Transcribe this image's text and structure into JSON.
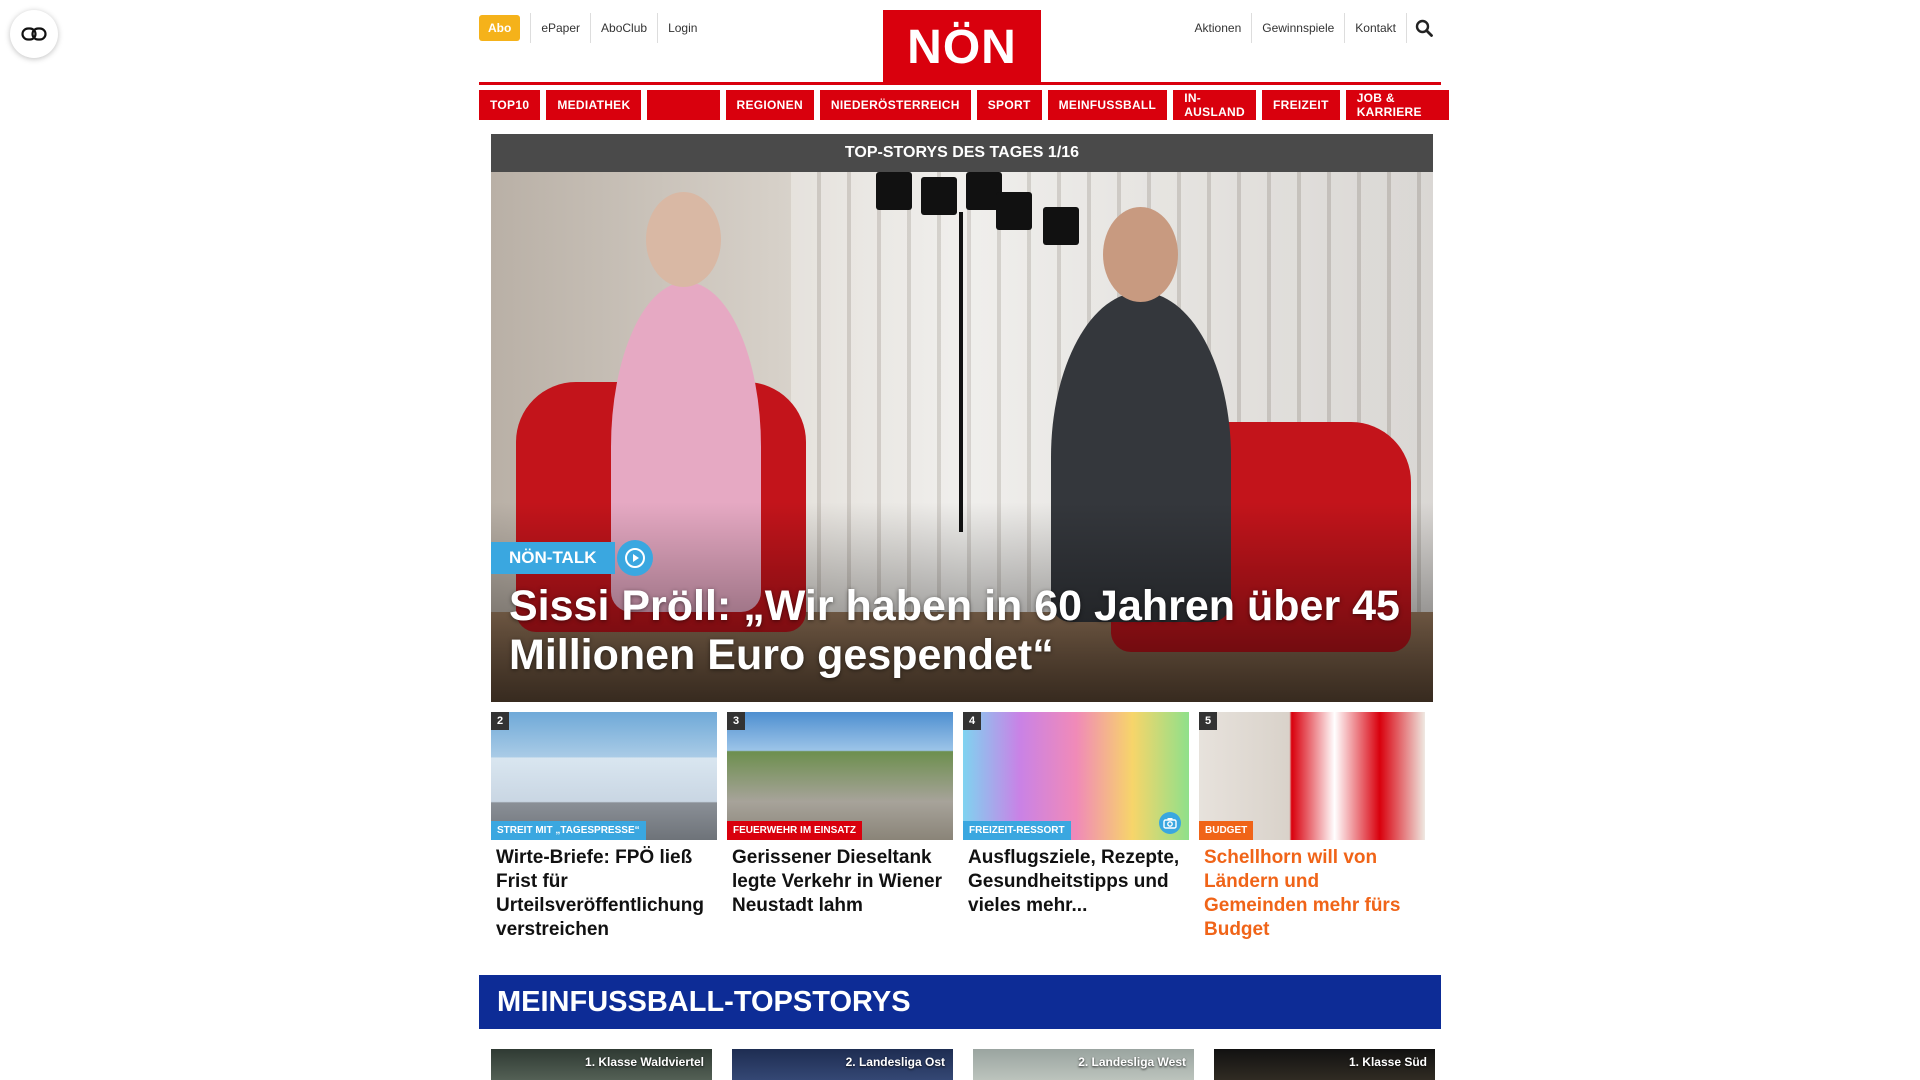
{
  "header": {
    "abo_label": "Abo",
    "left_links": [
      "ePaper",
      "AboClub",
      "Login"
    ],
    "logo_text": "NÖN",
    "right_links": [
      "Aktionen",
      "Gewinnspiele",
      "Kontakt"
    ]
  },
  "nav": {
    "items": [
      "TOP10",
      "MEDIATHEK",
      "",
      "REGIONEN",
      "NIEDERÖSTERREICH",
      "SPORT",
      "MEINFUSSBALL",
      "IN-AUSLAND",
      "FREIZEIT",
      "JOB & KARRIERE"
    ]
  },
  "hero": {
    "bar_label": "TOP-STORYS DES TAGES 1/16",
    "tag": "NÖN-TALK",
    "title": "Sissi Pröll: „Wir haben in 60 Jahren über 45 Millionen Euro gespendet“"
  },
  "cards": [
    {
      "rank": "2",
      "kicker": "STREIT MIT „TAGESPRESSE“",
      "title": "Wirte-Briefe: FPÖ ließ Frist für Urteilsveröffentlichung verstreichen"
    },
    {
      "rank": "3",
      "kicker": "FEUERWEHR IM EINSATZ",
      "title": "Gerissener Dieseltank legte Verkehr in Wiener Neustadt lahm"
    },
    {
      "rank": "4",
      "kicker": "FREIZEIT-RESSORT",
      "title": "Ausflugsziele, Rezepte, Gesundheitstipps und vieles mehr..."
    },
    {
      "rank": "5",
      "kicker": "BUDGET",
      "title": "Schellhorn will von Ländern und Gemeinden mehr fürs Budget"
    }
  ],
  "fussball": {
    "title": "MEINFUSSBALL-TOPSTORYS",
    "cards": [
      "1. Klasse Waldviertel",
      "2. Landesliga Ost",
      "2. Landesliga West",
      "1. Klasse Süd"
    ]
  },
  "colors": {
    "brand_red": "#d9000d",
    "abo_yellow": "#f5b21a",
    "accent_blue": "#3aa7e0",
    "fussball_blue": "#0d2c96",
    "highlight_orange": "#f06418"
  },
  "icons": [
    "reader-mode-icon",
    "search-icon",
    "play-icon",
    "camera-icon"
  ]
}
